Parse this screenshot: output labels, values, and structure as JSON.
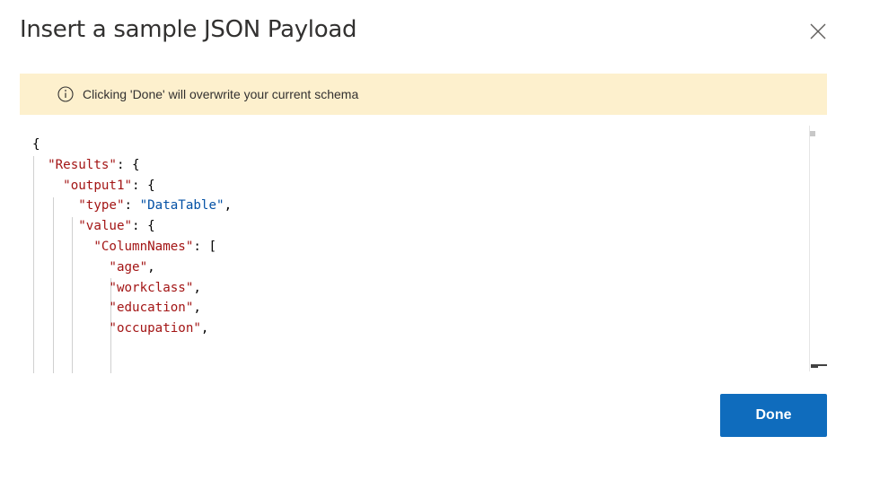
{
  "dialog": {
    "title": "Insert a sample JSON Payload",
    "banner_message": "Clicking 'Done' will overwrite your current schema",
    "done_label": "Done"
  },
  "editor": {
    "lines": [
      [
        {
          "t": "p",
          "v": "{"
        }
      ],
      [
        {
          "t": "p",
          "v": "  "
        },
        {
          "t": "k",
          "v": "\"Results\""
        },
        {
          "t": "p",
          "v": ": {"
        }
      ],
      [
        {
          "t": "p",
          "v": "    "
        },
        {
          "t": "k",
          "v": "\"output1\""
        },
        {
          "t": "p",
          "v": ": {"
        }
      ],
      [
        {
          "t": "p",
          "v": "      "
        },
        {
          "t": "k",
          "v": "\"type\""
        },
        {
          "t": "p",
          "v": ": "
        },
        {
          "t": "s",
          "v": "\"DataTable\""
        },
        {
          "t": "p",
          "v": ","
        }
      ],
      [
        {
          "t": "p",
          "v": "      "
        },
        {
          "t": "k",
          "v": "\"value\""
        },
        {
          "t": "p",
          "v": ": {"
        }
      ],
      [
        {
          "t": "p",
          "v": "        "
        },
        {
          "t": "k",
          "v": "\"ColumnNames\""
        },
        {
          "t": "p",
          "v": ": ["
        }
      ],
      [
        {
          "t": "p",
          "v": "          "
        },
        {
          "t": "k",
          "v": "\"age\""
        },
        {
          "t": "p",
          "v": ","
        }
      ],
      [
        {
          "t": "p",
          "v": "          "
        },
        {
          "t": "k",
          "v": "\"workclass\""
        },
        {
          "t": "p",
          "v": ","
        }
      ],
      [
        {
          "t": "p",
          "v": "          "
        },
        {
          "t": "k",
          "v": "\"education\""
        },
        {
          "t": "p",
          "v": ","
        }
      ],
      [
        {
          "t": "p",
          "v": "          "
        },
        {
          "t": "k",
          "v": "\"occupation\""
        },
        {
          "t": "p",
          "v": ","
        }
      ]
    ]
  },
  "colors": {
    "banner_bg": "#fdf0cd",
    "key": "#a31515",
    "string": "#0451a5",
    "primary_button": "#0f6cbd"
  },
  "icons": [
    "close-icon",
    "info-icon"
  ]
}
